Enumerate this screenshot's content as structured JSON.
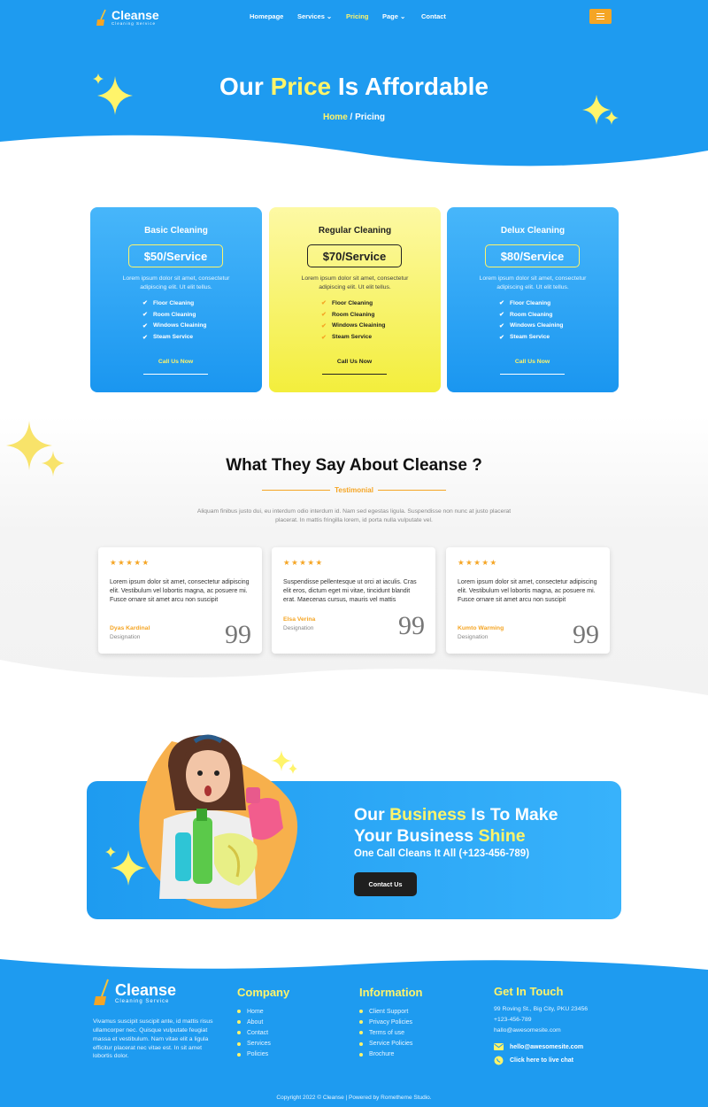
{
  "brand": {
    "name": "Cleanse",
    "tagline": "Cleaning Service"
  },
  "nav": {
    "items": [
      {
        "label": "Homepage",
        "has_dropdown": false
      },
      {
        "label": "Services",
        "has_dropdown": true
      },
      {
        "label": "Pricing",
        "has_dropdown": false,
        "active": true
      },
      {
        "label": "Page",
        "has_dropdown": true
      },
      {
        "label": "Contact",
        "has_dropdown": false
      }
    ],
    "menu_icon": "hamburger-icon"
  },
  "hero": {
    "title_before": "Our ",
    "title_highlight": "Price",
    "title_after": " Is Affordable",
    "breadcrumb_home": "Home",
    "breadcrumb_sep": " / ",
    "breadcrumb_current": "Pricing"
  },
  "pricing": [
    {
      "title": "Basic Cleaning",
      "price": "$50/Service",
      "desc": "Lorem ipsum dolor sit amet, consectetur adipiscing elit. Ut elit tellus.",
      "features": [
        "Floor Cleaning",
        "Room Cleaning",
        "Windows Cleaining",
        "Steam Service"
      ],
      "cta": "Call Us Now",
      "theme": "blue"
    },
    {
      "title": "Regular Cleaning",
      "price": "$70/Service",
      "desc": "Lorem ipsum dolor sit amet, consectetur adipiscing elit. Ut elit tellus.",
      "features": [
        "Floor Cleaning",
        "Room Cleaning",
        "Windows Cleaining",
        "Steam Service"
      ],
      "cta": "Call Us Now",
      "theme": "yellow"
    },
    {
      "title": "Delux Cleaning",
      "price": "$80/Service",
      "desc": "Lorem ipsum dolor sit amet, consectetur adipiscing elit. Ut elit tellus.",
      "features": [
        "Floor Cleaning",
        "Room Cleaning",
        "Windows Cleaining",
        "Steam Service"
      ],
      "cta": "Call Us Now",
      "theme": "blue"
    }
  ],
  "testimonials": {
    "title": "What They Say About Cleanse ?",
    "subtitle": "Testimonial",
    "desc": "Aliquam finibus justo dui, eu interdum odio interdum id. Nam sed egestas ligula. Suspendisse non nunc at justo placerat placerat. In mattis fringilla lorem, id porta nulla vulputate vel.",
    "items": [
      {
        "stars": 5,
        "text": "Lorem ipsum dolor sit amet, consectetur adipiscing elit. Vestibulum vel lobortis magna, ac posuere mi. Fusce ornare sit amet arcu non suscipit",
        "name": "Dyas Kardinal",
        "role": "Designation"
      },
      {
        "stars": 5,
        "text": "Suspendisse pellentesque ut orci at iaculis. Cras elit eros, dictum eget mi vitae, tincidunt blandit erat. Maecenas cursus, mauris vel mattis",
        "name": "Elsa Verina",
        "role": "Designation"
      },
      {
        "stars": 5,
        "text": "Lorem ipsum dolor sit amet, consectetur adipiscing elit. Vestibulum vel lobortis magna, ac posuere mi. Fusce ornare sit amet arcu non suscipit",
        "name": "Kumto Warming",
        "role": "Designation"
      }
    ],
    "quote_glyph": "99"
  },
  "cta": {
    "line1_before": "Our ",
    "line1_hl": "Business",
    "line1_after": " Is To Make",
    "line2_before": "Your Business ",
    "line2_hl": "Shine",
    "subtitle": "One Call Cleans It All (+123-456-789)",
    "button": "Contact Us"
  },
  "footer": {
    "about": "Vivamus suscipit suscipit ante, id mattis risus ullamcorper nec. Quisque vulputate feugiat massa et vestibulum. Nam vitae elit a ligula efficitur placerat nec vitae est. In sit amet lobortis dolor.",
    "company_title": "Company",
    "company_links": [
      "Home",
      "About",
      "Contact",
      "Services",
      "Policies"
    ],
    "info_title": "Information",
    "info_links": [
      "Client Support",
      "Privacy Policies",
      "Terms of use",
      "Service Policies",
      "Brochure"
    ],
    "contact_title": "Get In Touch",
    "address": "99 Roving St., Big City, PKU 23456",
    "phone": "+123-456-789",
    "email_plain": "hallo@awesomesite.com",
    "email_link": "hello@awesomesite.com",
    "chat_link": "Click here to live chat",
    "copyright": "Copyright 2022 © Cleanse | Powered by Rometheme Studio."
  },
  "colors": {
    "primary": "#1e9bf0",
    "accent": "#fff46a",
    "orange": "#f5a524",
    "dark": "#1f1f1f"
  }
}
